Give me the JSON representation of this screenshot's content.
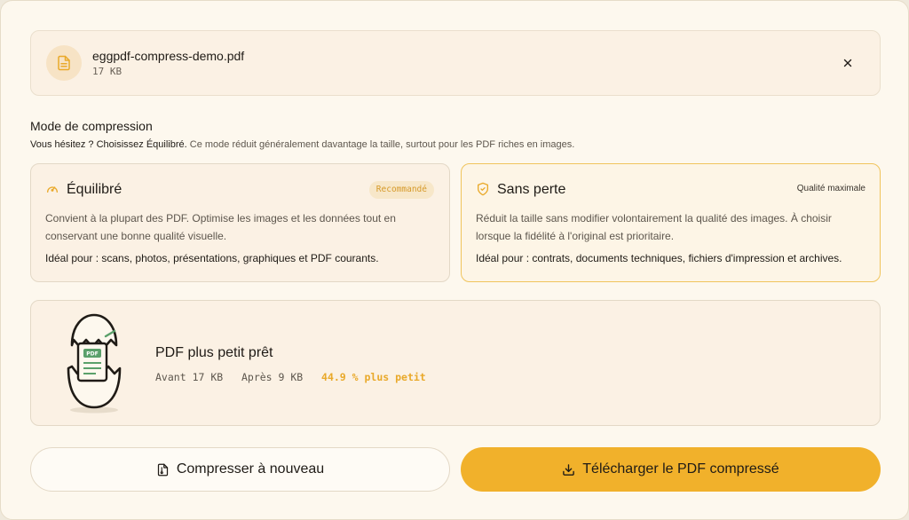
{
  "file": {
    "name": "eggpdf-compress-demo.pdf",
    "size": "17 KB",
    "icon": "file-text-icon",
    "close_icon": "close-icon"
  },
  "compression": {
    "title": "Mode de compression",
    "hint_strong": "Vous hésitez ? Choisissez Équilibré.",
    "hint_rest": " Ce mode réduit généralement davantage la taille, surtout pour les PDF riches en images.",
    "modes": [
      {
        "title": "Équilibré",
        "tag": "Recommandé",
        "icon": "gauge-icon",
        "description": "Convient à la plupart des PDF. Optimise les images et les données tout en conservant une bonne qualité visuelle.",
        "ideal": "Idéal pour : scans, photos, présentations, graphiques et PDF courants.",
        "selected": false
      },
      {
        "title": "Sans perte",
        "tag": "Qualité maximale",
        "icon": "shield-check-icon",
        "description": "Réduit la taille sans modifier volontairement la qualité des images. À choisir lorsque la fidélité à l'original est prioritaire.",
        "ideal": "Idéal pour : contrats, documents techniques, fichiers d'impression et archives.",
        "selected": true
      }
    ]
  },
  "result": {
    "title": "PDF plus petit prêt",
    "before_label": "Avant",
    "before_value": "17 KB",
    "after_label": "Après",
    "after_value": "9 KB",
    "gain": "44.9 % plus petit",
    "illustration_label": "PDF"
  },
  "actions": {
    "recompress_label": "Compresser à nouveau",
    "download_label": "Télécharger le PDF compressé"
  },
  "colors": {
    "accent": "#f1b12b",
    "selected_border": "#f0c45c",
    "gain_text": "#e9a92a",
    "illustration_green": "#5aa06a"
  }
}
